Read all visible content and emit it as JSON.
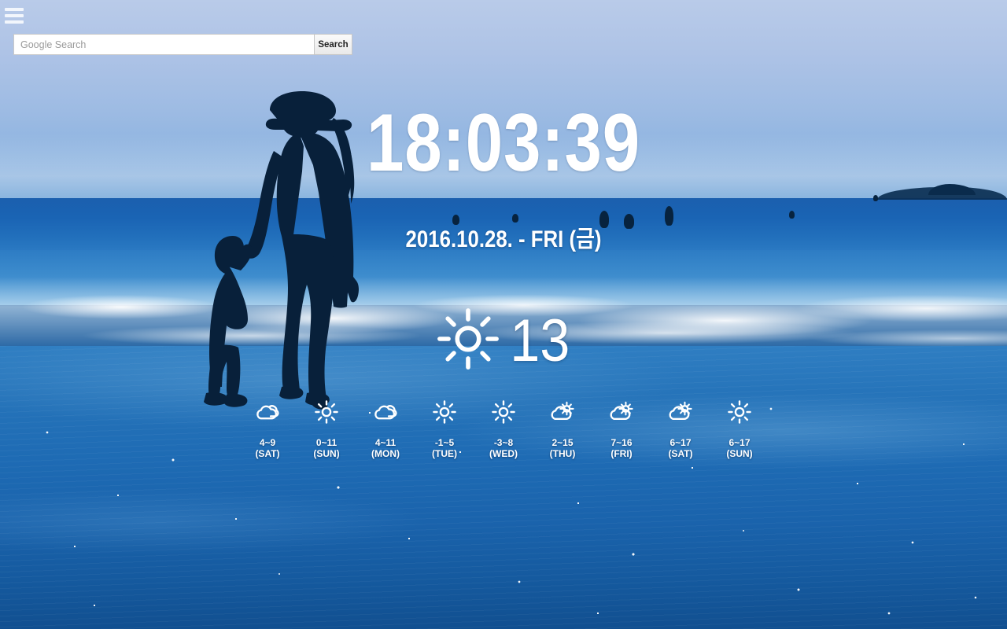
{
  "topbar": {
    "menu_icon": "hamburger-menu-icon",
    "search": {
      "placeholder": "Google Search",
      "value": "",
      "button_label": "Search"
    }
  },
  "clock": {
    "time": "18:03:39",
    "date": "2016.10.28. - FRI (금)"
  },
  "current_weather": {
    "icon": "sun-icon",
    "condition": "sunny",
    "temperature": "13"
  },
  "forecast": [
    {
      "icon": "cloudy-icon",
      "condition": "cloudy",
      "temp": "4~9",
      "day": "(SAT)"
    },
    {
      "icon": "sun-icon",
      "condition": "sunny",
      "temp": "0~11",
      "day": "(SUN)"
    },
    {
      "icon": "cloudy-icon",
      "condition": "cloudy",
      "temp": "4~11",
      "day": "(MON)"
    },
    {
      "icon": "sun-icon",
      "condition": "sunny",
      "temp": "-1~5",
      "day": "(TUE)"
    },
    {
      "icon": "sun-icon",
      "condition": "sunny",
      "temp": "-3~8",
      "day": "(WED)"
    },
    {
      "icon": "partly-cloudy-icon",
      "condition": "partly cloudy",
      "temp": "2~15",
      "day": "(THU)"
    },
    {
      "icon": "partly-cloudy-icon",
      "condition": "partly cloudy",
      "temp": "7~16",
      "day": "(FRI)"
    },
    {
      "icon": "partly-cloudy-icon",
      "condition": "partly cloudy",
      "temp": "6~17",
      "day": "(SAT)"
    },
    {
      "icon": "sun-icon",
      "condition": "sunny",
      "temp": "6~17",
      "day": "(SUN)"
    }
  ],
  "colors": {
    "text": "#ffffff",
    "sky": "#aec3e6",
    "sea": "#1b5fae",
    "shallow": "#1e6bb4",
    "silhouette": "#081f38"
  }
}
